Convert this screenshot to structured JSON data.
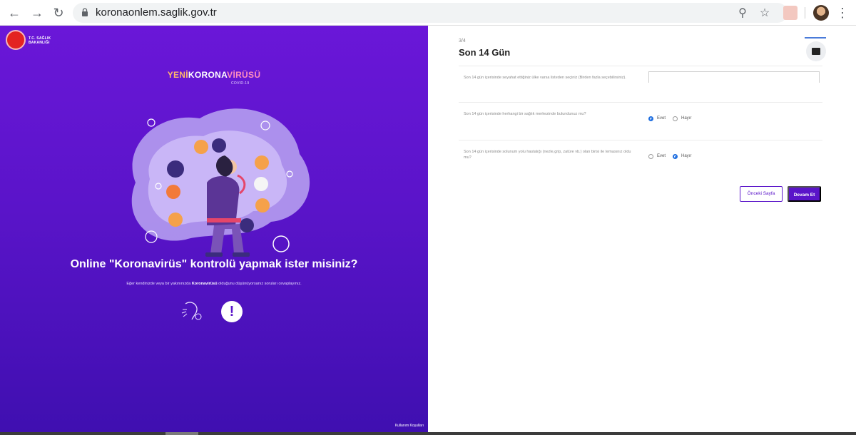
{
  "browser": {
    "url": "koronaonlem.saglik.gov.tr",
    "icons": [
      "back-icon",
      "forward-icon",
      "reload-icon",
      "lock-icon",
      "zoom-icon",
      "star-icon",
      "pdf-extension-icon",
      "profile-avatar",
      "kebab-menu-icon"
    ]
  },
  "hero": {
    "ministry_name": "T.C. SAĞLIK BAKANLIĞI",
    "brand_yeni": "YENİ",
    "brand_korona": "KORONA",
    "brand_virus": "VİRÜSÜ",
    "brand_sub": "COVID-19",
    "title": "Online \"Koronavirüs\" kontrolü yapmak ister misiniz?",
    "subtitle_pre": "Eğer kendinizde veya bir yakınınızda ",
    "subtitle_bold": "Koronavirüsü",
    "subtitle_post": " olduğunu düşünüyorsanız soruları cevaplayınız.",
    "terms_link": "Kullanım Koşulları",
    "colors": {
      "gradient_top": "#6a17d8",
      "gradient_bottom": "#3f0fb0"
    }
  },
  "form": {
    "step": "3/4",
    "title": "Son 14 Gün",
    "questions": [
      {
        "text": "Son 14 gün içerisinde seyahat ettiğiniz ülke varsa listeden seçiniz (Birden fazla seçebilirsiniz).",
        "value": ""
      },
      {
        "text": "Son 14 gün içerisinde herhangi bir sağlık merkezinde bulundunuz mu?",
        "yes": "Evet",
        "no": "Hayır",
        "selected": "Evet"
      },
      {
        "text": "Son 14 gün içerisinde solunum yolu hastalığı (nezle,grip, zatüre vb.) olan birisi ile temasınız oldu mu?",
        "yes": "Evet",
        "no": "Hayır",
        "selected": "Hayır"
      }
    ],
    "prev_label": "Önceki Sayfa",
    "next_label": "Devam Et",
    "colors": {
      "primary": "#5a14c9",
      "radio": "#1e6ee0"
    }
  }
}
